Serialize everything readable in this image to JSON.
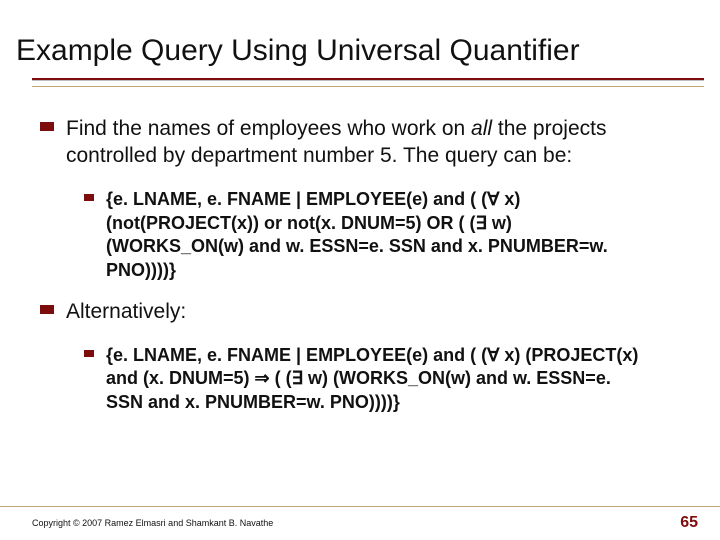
{
  "title": "Example Query Using Universal Quantifier",
  "body": {
    "p1_a": "Find the names of employees who work on ",
    "p1_b": "all",
    "p1_c": " the projects controlled by department number 5. The query can be:",
    "q1": "{e. LNAME, e. FNAME | EMPLOYEE(e) and ( (∀ x) (not(PROJECT(x)) or not(x. DNUM=5) OR ( (∃ w) (WORKS_ON(w) and w. ESSN=e. SSN and x. PNUMBER=w. PNO))))}",
    "p2": "Alternatively:",
    "q2": "{e. LNAME, e. FNAME | EMPLOYEE(e) and ( (∀ x) (PROJECT(x) and (x. DNUM=5) ⇒ ( (∃ w) (WORKS_ON(w) and w. ESSN=e. SSN and x. PNUMBER=w. PNO))))}"
  },
  "footer": {
    "copyright": "Copyright © 2007 Ramez Elmasri and Shamkant B. Navathe",
    "page": "65"
  }
}
